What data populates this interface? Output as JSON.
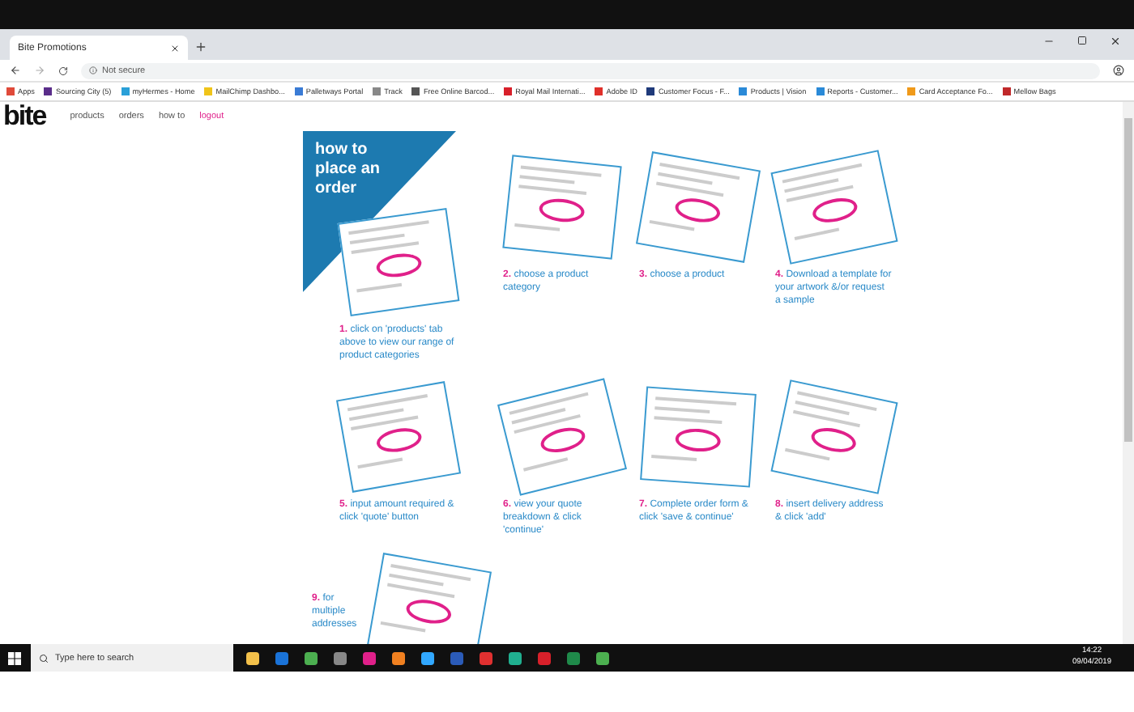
{
  "browser": {
    "tab": {
      "title": "Bite Promotions"
    },
    "address": {
      "security": "Not secure"
    },
    "bookmarks": [
      {
        "label": "Apps",
        "color": "#e04a3a"
      },
      {
        "label": "Sourcing City (5)",
        "color": "#5a2d8a"
      },
      {
        "label": "myHermes - Home",
        "color": "#2aa0d8"
      },
      {
        "label": "MailChimp Dashbo...",
        "color": "#f0c419"
      },
      {
        "label": "Palletways Portal",
        "color": "#3a7bd5"
      },
      {
        "label": "Track",
        "color": "#888888"
      },
      {
        "label": "Free Online Barcod...",
        "color": "#555555"
      },
      {
        "label": "Royal Mail Internati...",
        "color": "#d8202a"
      },
      {
        "label": "Adobe ID",
        "color": "#e0302a"
      },
      {
        "label": "Customer Focus - F...",
        "color": "#1f3a7a"
      },
      {
        "label": "Products | Vision",
        "color": "#2a8ad8"
      },
      {
        "label": "Reports - Customer...",
        "color": "#2a8ad8"
      },
      {
        "label": "Card Acceptance Fo...",
        "color": "#f09a1a"
      },
      {
        "label": "Mellow Bags",
        "color": "#c0282a"
      }
    ]
  },
  "site_nav": {
    "logo": "bite",
    "links": [
      {
        "label": "products",
        "kind": "normal"
      },
      {
        "label": "orders",
        "kind": "normal"
      },
      {
        "label": "how to",
        "kind": "normal"
      },
      {
        "label": "logout",
        "kind": "accent"
      }
    ]
  },
  "infographic": {
    "title": "how to place an order",
    "steps": [
      {
        "number": "1.",
        "text": "click on 'products' tab above to view our range of product categories"
      },
      {
        "number": "2.",
        "text": "choose a product category"
      },
      {
        "number": "3.",
        "text": "choose a product"
      },
      {
        "number": "4.",
        "text": "Download a template for your artwork &/or request a sample"
      },
      {
        "number": "5.",
        "text": "input amount required & click 'quote' button"
      },
      {
        "number": "6.",
        "text": "view your quote breakdown & click 'continue'"
      },
      {
        "number": "7.",
        "text": "Complete order form & click 'save & continue'"
      },
      {
        "number": "8.",
        "text": "insert delivery address & click 'add'"
      },
      {
        "number": "9.",
        "text": "for multiple addresses"
      }
    ]
  },
  "taskbar": {
    "search_placeholder": "Type here to search",
    "time": "14:22",
    "date": "09/04/2019"
  }
}
